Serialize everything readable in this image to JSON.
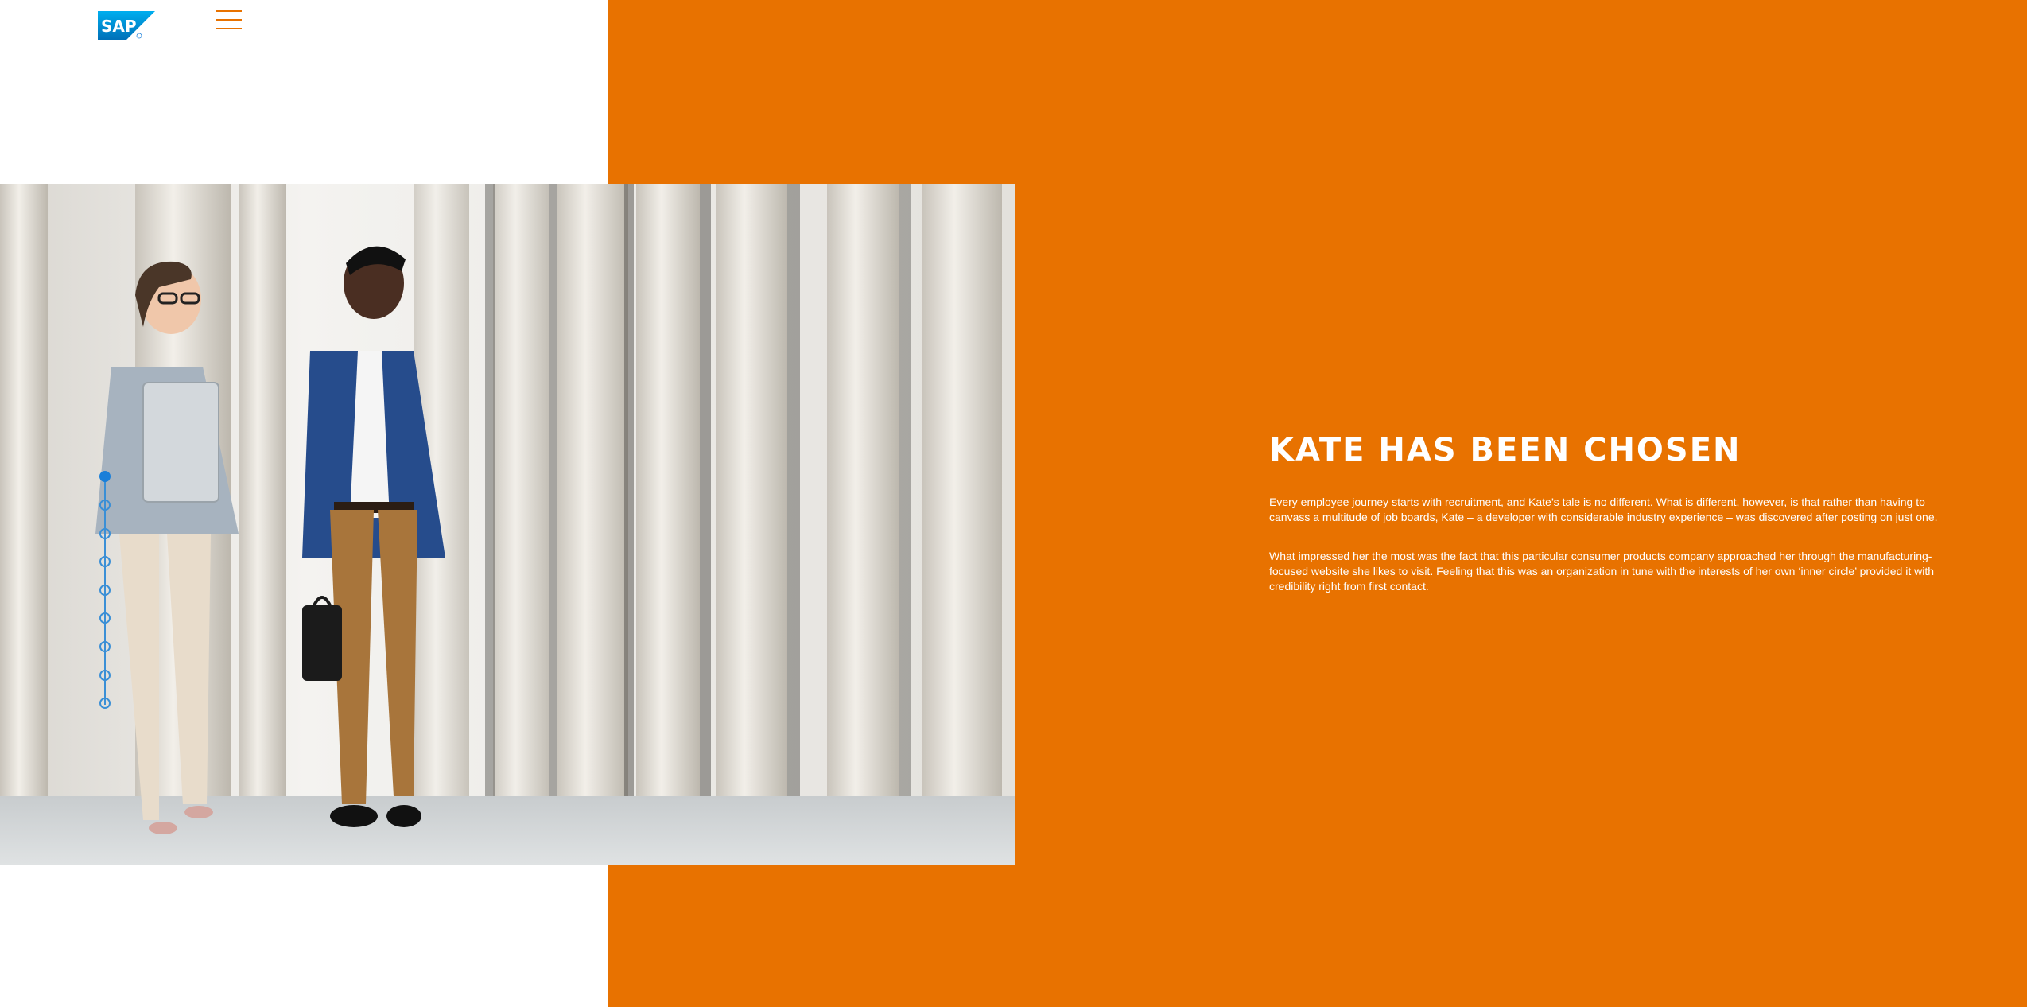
{
  "header": {
    "logo_text": "SAP",
    "logo_icon": "sap-logo",
    "menu_icon": "hamburger-menu-icon"
  },
  "colors": {
    "accent_orange": "#e87200",
    "sap_blue": "#1a7fd9",
    "progress_blue": "#3a8fd6"
  },
  "progress_nav": {
    "total_steps": 9,
    "active_step": 1
  },
  "content": {
    "title": "KATE HAS BEEN CHOSEN",
    "paragraph_1": "Every employee journey starts with recruitment, and Kate’s tale is no different. What is different, however, is that rather than having to canvass a multitude of job boards, Kate – a developer with considerable industry experience – was discovered after posting on just one.",
    "paragraph_2": "What impressed her the most was the fact that this particular consumer products company approached her through the manufacturing-focused website she likes to visit. Feeling that this was an organization in tune with the interests of her own ‘inner circle’ provided it with credibility right from first contact."
  }
}
